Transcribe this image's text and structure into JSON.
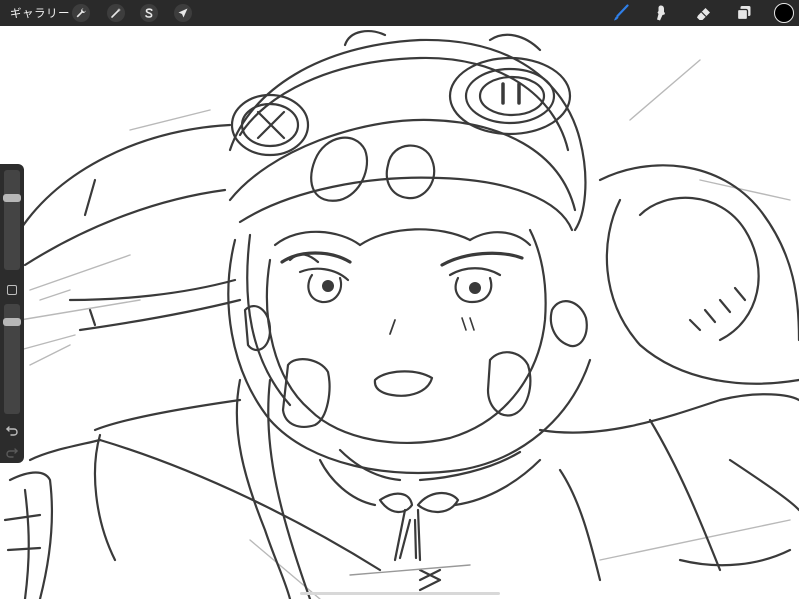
{
  "toolbar": {
    "gallery_label": "ギャラリー",
    "left_tools": [
      {
        "name": "actions-wrench-icon"
      },
      {
        "name": "adjustments-wand-icon"
      },
      {
        "name": "selection-s-icon"
      },
      {
        "name": "transform-arrow-icon"
      }
    ],
    "right_tools": [
      {
        "name": "brush-icon",
        "active": true
      },
      {
        "name": "smudge-icon",
        "active": false
      },
      {
        "name": "eraser-icon",
        "active": false
      },
      {
        "name": "layers-icon",
        "active": false
      }
    ],
    "current_color": "#000000",
    "accent_color": "#2f7fe8"
  },
  "sidebar": {
    "brush_size_level": 0.22,
    "opacity_level": 0.18
  }
}
